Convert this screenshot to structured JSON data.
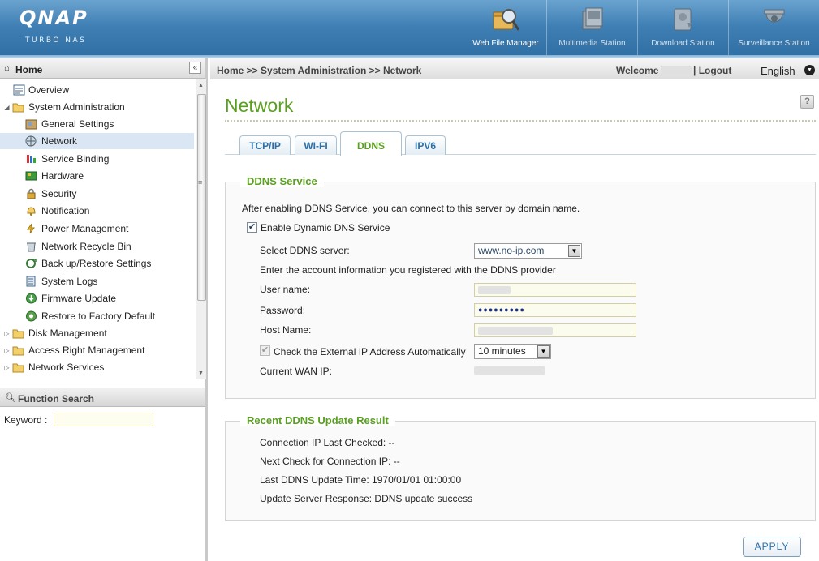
{
  "brand": {
    "logo": "QNAP",
    "tagline": "TURBO NAS"
  },
  "apps": [
    {
      "label": "Web File Manager",
      "icon": "web-file-manager-icon",
      "active": true
    },
    {
      "label": "Multimedia Station",
      "icon": "multimedia-station-icon",
      "active": false
    },
    {
      "label": "Download Station",
      "icon": "download-station-icon",
      "active": false
    },
    {
      "label": "Surveillance Station",
      "icon": "surveillance-station-icon",
      "active": false
    }
  ],
  "sidebar": {
    "title": "Home",
    "collapse_label": "«",
    "items": [
      {
        "label": "Overview",
        "icon": "overview-icon"
      },
      {
        "label": "System Administration",
        "icon": "folder-open-icon"
      },
      {
        "label": "General Settings",
        "icon": "general-settings-icon"
      },
      {
        "label": "Network",
        "icon": "network-icon",
        "selected": true
      },
      {
        "label": "Service Binding",
        "icon": "service-binding-icon"
      },
      {
        "label": "Hardware",
        "icon": "hardware-icon"
      },
      {
        "label": "Security",
        "icon": "security-icon"
      },
      {
        "label": "Notification",
        "icon": "notification-icon"
      },
      {
        "label": "Power Management",
        "icon": "power-management-icon"
      },
      {
        "label": "Network Recycle Bin",
        "icon": "recycle-bin-icon"
      },
      {
        "label": "Back up/Restore Settings",
        "icon": "backup-restore-icon"
      },
      {
        "label": "System Logs",
        "icon": "system-logs-icon"
      },
      {
        "label": "Firmware Update",
        "icon": "firmware-update-icon"
      },
      {
        "label": "Restore to Factory Default",
        "icon": "factory-default-icon"
      },
      {
        "label": "Disk Management",
        "icon": "folder-icon"
      },
      {
        "label": "Access Right Management",
        "icon": "folder-icon"
      },
      {
        "label": "Network Services",
        "icon": "folder-icon"
      }
    ]
  },
  "function_search": {
    "title": "Function Search",
    "keyword_label": "Keyword :",
    "keyword_value": ""
  },
  "topbar": {
    "breadcrumb": "Home >> System Administration >> Network",
    "welcome": "Welcome",
    "logout": "| Logout",
    "language": "English"
  },
  "page": {
    "title": "Network",
    "help": "?"
  },
  "tabs": [
    {
      "label": "TCP/IP",
      "active": false
    },
    {
      "label": "WI-FI",
      "active": false
    },
    {
      "label": "DDNS",
      "active": true
    },
    {
      "label": "IPV6",
      "active": false
    }
  ],
  "ddns": {
    "legend": "DDNS Service",
    "intro": "After enabling DDNS Service, you can connect to this server by domain name.",
    "enable_label": "Enable Dynamic DNS Service",
    "enable_checked": true,
    "server_label": "Select DDNS server:",
    "server_value": "www.no-ip.com",
    "account_info": "Enter the account information you registered with the DDNS provider",
    "username_label": "User name:",
    "password_label": "Password:",
    "password_value": "●●●●●●●●●",
    "hostname_label": "Host Name:",
    "check_ip_label": "Check the External IP Address Automatically",
    "check_ip_checked": true,
    "check_interval": "10 minutes",
    "wan_ip_label": "Current WAN IP:"
  },
  "recent": {
    "legend": "Recent DDNS Update Result",
    "lines": [
      "Connection IP Last Checked: --",
      "Next Check for Connection IP: --",
      "Last DDNS Update Time: 1970/01/01 01:00:00",
      "Update Server Response: DDNS update success"
    ]
  },
  "apply_label": "APPLY",
  "colors": {
    "accent_green": "#5aa020",
    "tab_blue": "#2a6fa8",
    "header_blue": "#3f7fb4"
  }
}
